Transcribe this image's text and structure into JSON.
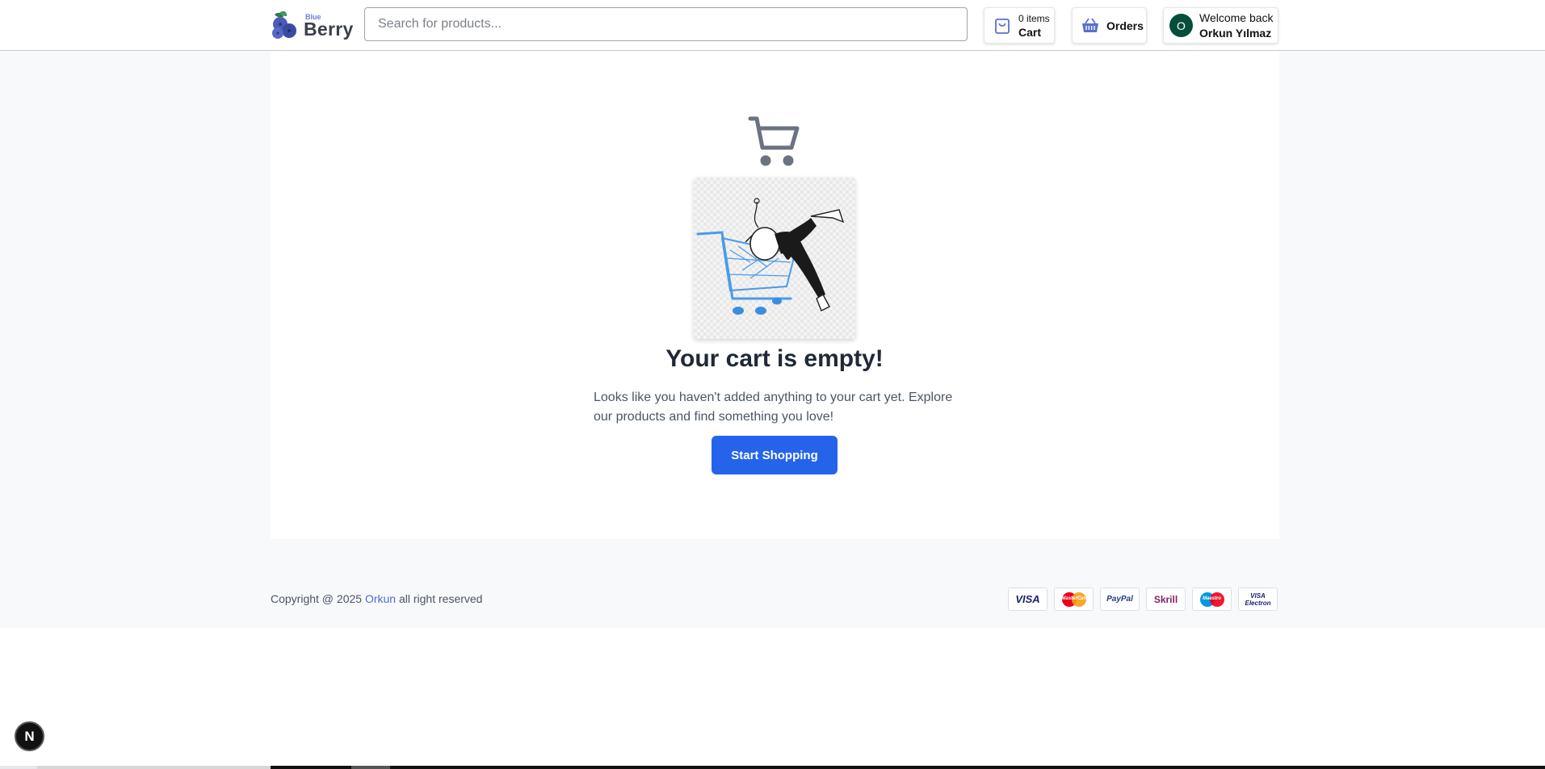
{
  "brand": {
    "top": "Blue",
    "main": "Berry"
  },
  "search": {
    "placeholder": "Search for products..."
  },
  "header": {
    "cart": {
      "count_label": "0 items",
      "label": "Cart"
    },
    "orders": {
      "label": "Orders"
    },
    "user": {
      "avatar_initial": "O",
      "greeting": "Welcome back",
      "name": "Orkun Yılmaz"
    }
  },
  "main": {
    "title": "Your cart is empty!",
    "description": "Looks like you haven't added anything to your cart yet. Explore our products and find something you love!",
    "button": "Start Shopping"
  },
  "footer": {
    "copyright_prefix": "Copyright @ 2025",
    "copyright_link": "Orkun",
    "copyright_suffix": "all right reserved",
    "payments": [
      "VISA",
      "MasterCard",
      "PayPal",
      "Skrill",
      "Maestro",
      "VISA Electron"
    ]
  },
  "dev_badge": {
    "label": "N"
  },
  "colors": {
    "accent": "#2563eb",
    "avatar": "#064e3b",
    "brand_blue": "#6b7fd7"
  }
}
